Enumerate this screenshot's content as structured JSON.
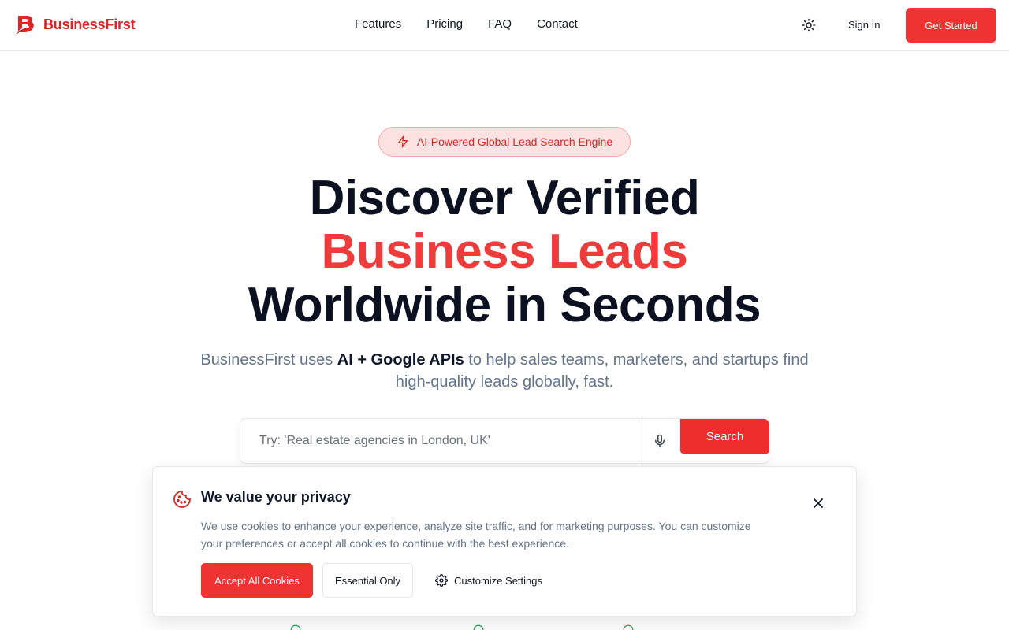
{
  "brand": {
    "name": "BusinessFirst",
    "color": "#dc2626"
  },
  "nav": {
    "items": [
      {
        "label": "Features"
      },
      {
        "label": "Pricing"
      },
      {
        "label": "FAQ"
      },
      {
        "label": "Contact"
      }
    ]
  },
  "header": {
    "theme_icon": "sun-icon",
    "signin_label": "Sign In",
    "cta_label": "Get Started"
  },
  "hero": {
    "badge": "AI-Powered Global Lead Search Engine",
    "headline_line1": "Discover Verified",
    "headline_line2": "Business Leads",
    "headline_line3": "Worldwide in Seconds",
    "sub_before": "BusinessFirst uses ",
    "sub_strong": "AI + Google APIs",
    "sub_after": " to help sales teams, marketers, and startups find high-quality leads globally, fast."
  },
  "search": {
    "placeholder": "Try: 'Real estate agencies in London, UK'",
    "value": "",
    "button_label": "Search",
    "mic_icon": "microphone-icon"
  },
  "cookie": {
    "title": "We value your privacy",
    "text": "We use cookies to enhance your experience, analyze site traffic, and for marketing purposes. You can customize your preferences or accept all cookies to continue with the best experience.",
    "accept_label": "Accept All Cookies",
    "essential_label": "Essential Only",
    "customize_label": "Customize Settings"
  },
  "colors": {
    "accent": "#ef3232",
    "headline_accent": "#ef3b3b",
    "muted_text": "#64748b",
    "check_green": "#16a34a"
  }
}
